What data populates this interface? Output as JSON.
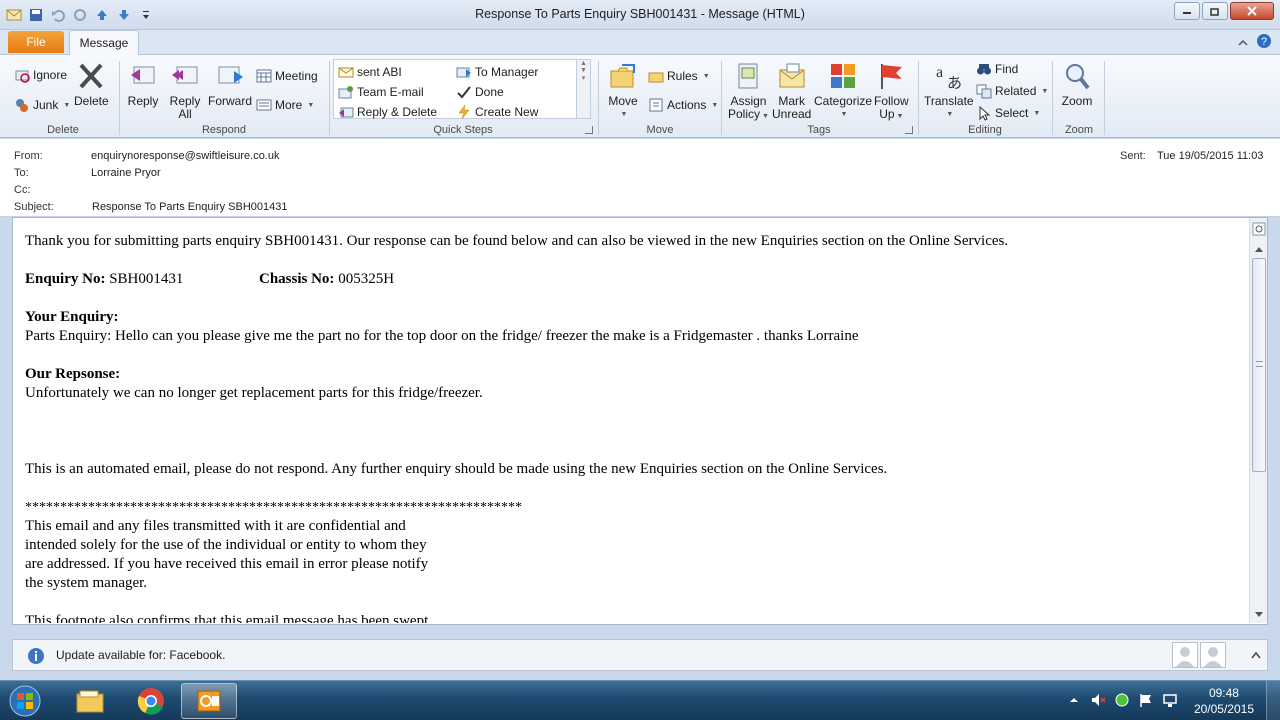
{
  "window": {
    "title": "Response To Parts Enquiry SBH001431  -  Message (HTML)"
  },
  "tabs": {
    "file": "File",
    "message": "Message"
  },
  "ribbon": {
    "delete_group": {
      "label": "Delete",
      "ignore": "Ignore",
      "junk": "Junk",
      "delete": "Delete"
    },
    "respond_group": {
      "label": "Respond",
      "reply": "Reply",
      "reply_all_1": "Reply",
      "reply_all_2": "All",
      "forward": "Forward",
      "meeting": "Meeting",
      "more": "More"
    },
    "quick_steps": {
      "label": "Quick Steps",
      "items": [
        "sent ABI",
        "To Manager",
        "Team E-mail",
        "Done",
        "Reply & Delete",
        "Create New"
      ]
    },
    "move_group": {
      "label": "Move",
      "move": "Move",
      "rules": "Rules",
      "actions": "Actions"
    },
    "tags_group": {
      "label": "Tags",
      "assign_1": "Assign",
      "assign_2": "Policy",
      "mark_1": "Mark",
      "mark_2": "Unread",
      "categorize": "Categorize",
      "follow_1": "Follow",
      "follow_2": "Up"
    },
    "editing_group": {
      "label": "Editing",
      "translate": "Translate",
      "find": "Find",
      "related": "Related",
      "select": "Select"
    },
    "zoom_group": {
      "label": "Zoom",
      "zoom": "Zoom"
    }
  },
  "header": {
    "from_label": "From:",
    "from": "enquirynoresponse@swiftleisure.co.uk",
    "to_label": "To:",
    "to": "Lorraine Pryor",
    "cc_label": "Cc:",
    "cc": "",
    "subject_label": "Subject:",
    "subject": "Response To Parts Enquiry SBH001431",
    "sent_label": "Sent:",
    "sent": "Tue 19/05/2015 11:03"
  },
  "body": {
    "intro": "Thank you for submitting parts enquiry SBH001431. Our response can be found below and can also be viewed in the new Enquiries section on the Online Services.",
    "enquiry_no_label": "Enquiry No:",
    "enquiry_no": "SBH001431",
    "chassis_no_label": "Chassis No:",
    "chassis_no": "005325H",
    "your_enquiry_label": "Your Enquiry:",
    "your_enquiry": "Parts Enquiry: Hello can you please give me the part no for the top door on the fridge/ freezer the make is a Fridgemaster . thanks Lorraine",
    "our_response_label": "Our Repsonse:",
    "our_response": "Unfortunately we can no longer get replacement parts for this fridge/freezer.",
    "automated": "This is an automated email, please do not respond. Any further enquiry should be made using the new Enquiries section on the Online Services.",
    "stars": "***********************************************************************",
    "disclaimer": [
      "This email and any files transmitted with it are confidential and",
      "intended solely for the use of the individual or entity to whom they",
      "are addressed. If you have received this email in error please notify",
      "the system manager."
    ],
    "footnote": "This footnote also confirms that this email message has been swept"
  },
  "infobar": {
    "text": "Update available for: Facebook."
  },
  "taskbar": {
    "time": "09:48",
    "date": "20/05/2015"
  }
}
